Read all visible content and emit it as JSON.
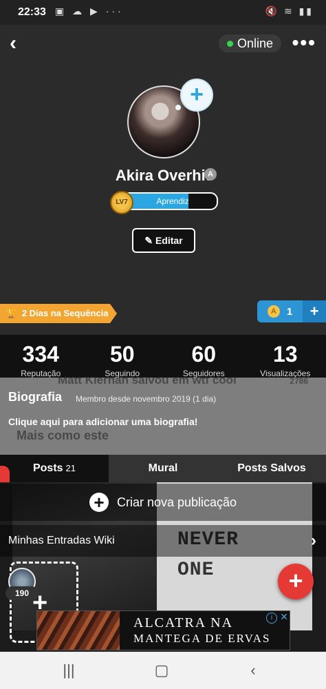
{
  "status_bar": {
    "time": "22:33",
    "left_icons": "▣ ☁ ▶ ···",
    "right_icons": "🔇 ≋ ▮▮"
  },
  "header": {
    "online_label": "Online"
  },
  "profile": {
    "name": "Akira Overhit",
    "level_label": "LV7",
    "level_title": "Aprendiz Desenhista",
    "level_progress": 0.7,
    "edit_label": "Editar"
  },
  "streak": {
    "label": "2 Dias na Sequência"
  },
  "coins": {
    "count": "1"
  },
  "stats": [
    {
      "value": "334",
      "label": "Reputação"
    },
    {
      "value": "50",
      "label": "Seguindo"
    },
    {
      "value": "60",
      "label": "Seguidores"
    },
    {
      "value": "13",
      "label": "Visualizações"
    }
  ],
  "bio": {
    "title": "Biografia",
    "member_since": "Membro desde novembro 2019 (1 dia)",
    "cta": "Clique aqui para adicionar uma biografia!",
    "ghost_line1": "Matt Kiernan salvou em wtf cool",
    "ghost_line2": "Mais como este",
    "ghost_count": "2786"
  },
  "tabs": [
    {
      "label": "Posts",
      "count": "21"
    },
    {
      "label": "Mural"
    },
    {
      "label": "Posts Salvos"
    }
  ],
  "content": {
    "create_label": "Criar nova publicação",
    "wiki_label": "Minhas Entradas Wiki",
    "wiki_count": "190",
    "never_text": "NEVER ONE"
  },
  "ad": {
    "line1": "ALCATRA NA",
    "line2": "MANTEGA DE ERVAS"
  },
  "colors": {
    "accent_blue": "#2aa6e0",
    "streak_orange": "#f2a531",
    "fab_red": "#e53935",
    "online_green": "#39d353"
  }
}
